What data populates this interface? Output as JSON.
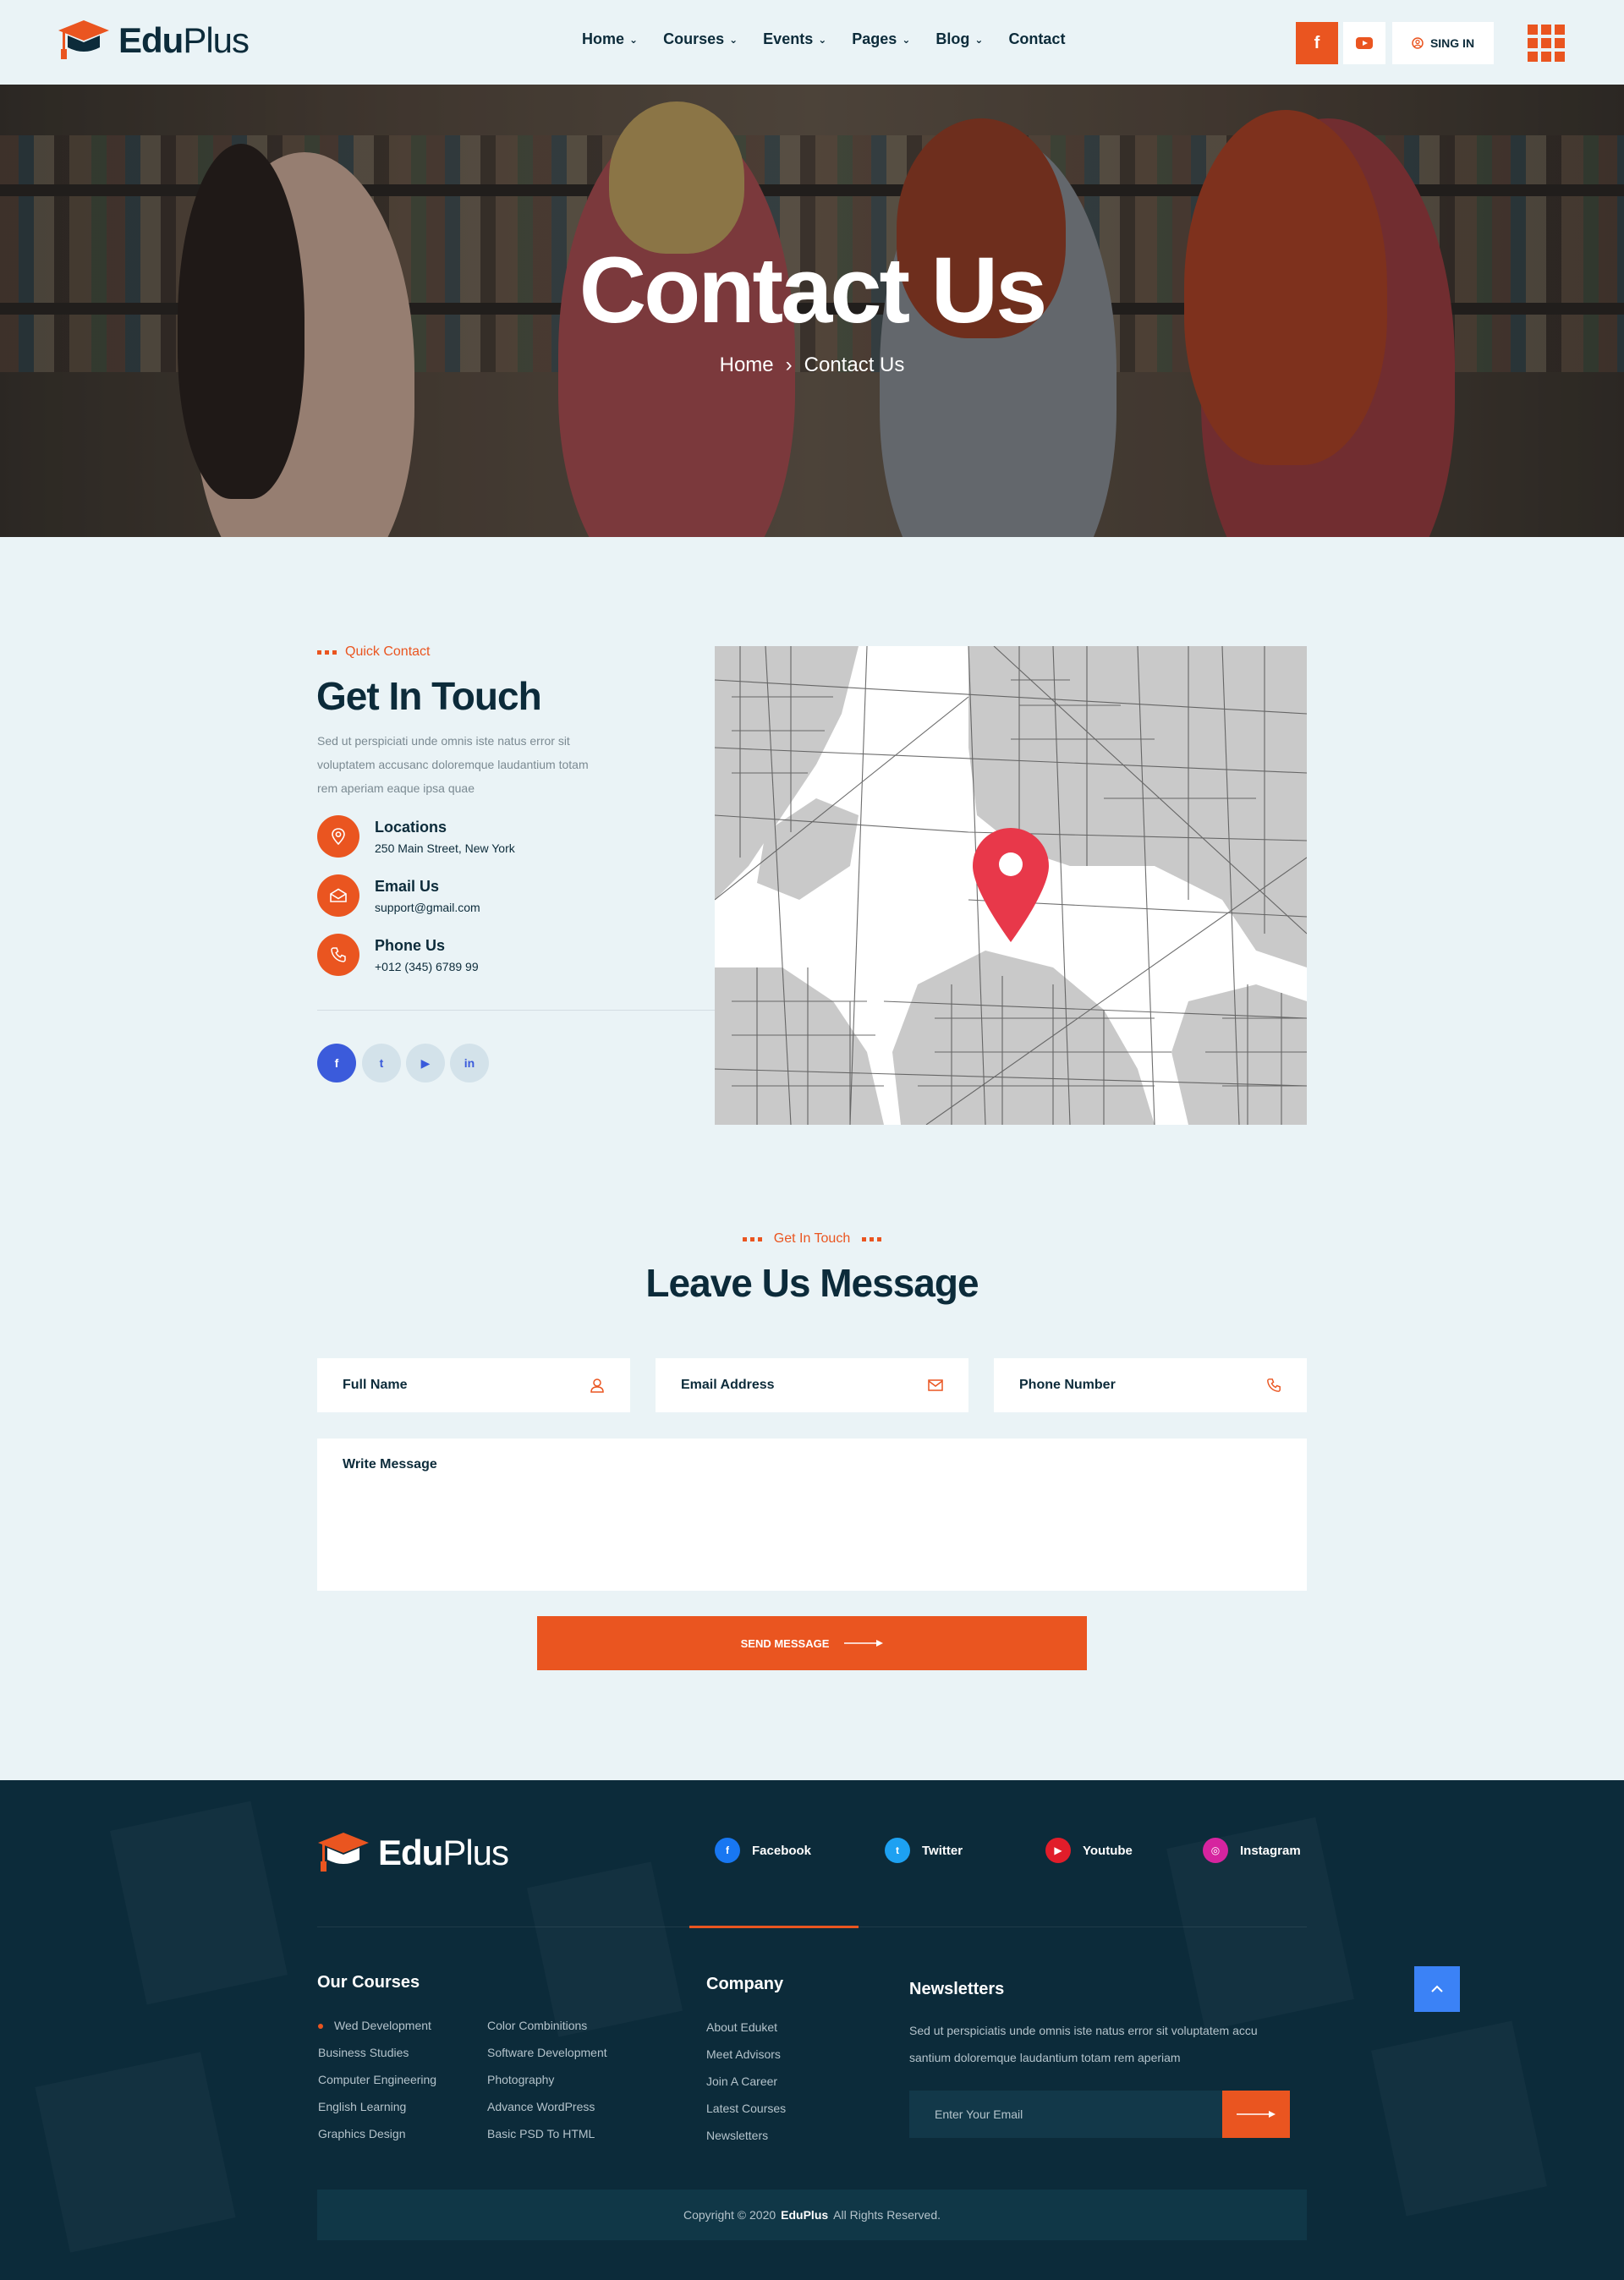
{
  "brand": {
    "bold": "Edu",
    "light": "Plus"
  },
  "nav": [
    {
      "label": "Home",
      "dropdown": true
    },
    {
      "label": "Courses",
      "dropdown": true
    },
    {
      "label": "Events",
      "dropdown": true
    },
    {
      "label": "Pages",
      "dropdown": true
    },
    {
      "label": "Blog",
      "dropdown": true
    },
    {
      "label": "Contact",
      "dropdown": false
    }
  ],
  "header": {
    "signin_label": "SING IN",
    "fb_glyph": "f"
  },
  "hero": {
    "title": "Contact Us",
    "crumb_home": "Home",
    "crumb_sep": "›",
    "crumb_current": "Contact Us"
  },
  "contact": {
    "label": "Quick Contact",
    "title": "Get In Touch",
    "desc": "Sed ut perspiciati unde omnis iste natus error sit voluptatem accusanc doloremque laudantium totam rem aperiam eaque ipsa quae",
    "items": [
      {
        "title": "Locations",
        "value": "250 Main Street, New York",
        "icon": "location-pin-icon"
      },
      {
        "title": "Email Us",
        "value": "support@gmail.com",
        "icon": "envelope-icon"
      },
      {
        "title": "Phone Us",
        "value": "+012 (345) 6789 99",
        "icon": "phone-icon"
      }
    ],
    "social": [
      {
        "name": "facebook-icon",
        "glyph": "f"
      },
      {
        "name": "twitter-icon",
        "glyph": "t"
      },
      {
        "name": "youtube-icon",
        "glyph": "▶"
      },
      {
        "name": "linkedin-icon",
        "glyph": "in"
      }
    ]
  },
  "form": {
    "label": "Get In Touch",
    "title": "Leave Us Message",
    "full_name": "Full Name",
    "email": "Email Address",
    "phone": "Phone Number",
    "message": "Write  Message",
    "submit": "SEND MESSAGE"
  },
  "footer": {
    "social": [
      {
        "label": "Facebook",
        "glyph": "f",
        "color": "#1877f2"
      },
      {
        "label": "Twitter",
        "glyph": "t",
        "color": "#1da1f2"
      },
      {
        "label": "Youtube",
        "glyph": "▶",
        "color": "#e11d2a"
      },
      {
        "label": "Instagram",
        "glyph": "◎",
        "color": "#d6249f"
      }
    ],
    "courses_heading": "Our Courses",
    "courses_col1": [
      "Wed Development",
      "Business Studies",
      "Computer Engineering",
      "English Learning",
      "Graphics Design"
    ],
    "courses_col2": [
      "Color Combinitions",
      "Software Development",
      "Photography",
      "Advance WordPress",
      "Basic PSD To HTML"
    ],
    "company_heading": "Company",
    "company": [
      "About Eduket",
      "Meet Advisors",
      "Join A Career",
      "Latest Courses",
      "Newsletters"
    ],
    "news_heading": "Newsletters",
    "news_desc": "Sed ut perspiciatis unde omnis iste natus error sit voluptatem accu santium doloremque laudantium totam rem aperiam",
    "news_placeholder": "Enter Your Email",
    "copyright_pre": "Copyright © 2020",
    "copyright_brand": "EduPlus",
    "copyright_post": "All Rights Reserved."
  },
  "colors": {
    "accent": "#ea5520",
    "dark": "#0c2b3a",
    "bg": "#eaf3f6"
  }
}
